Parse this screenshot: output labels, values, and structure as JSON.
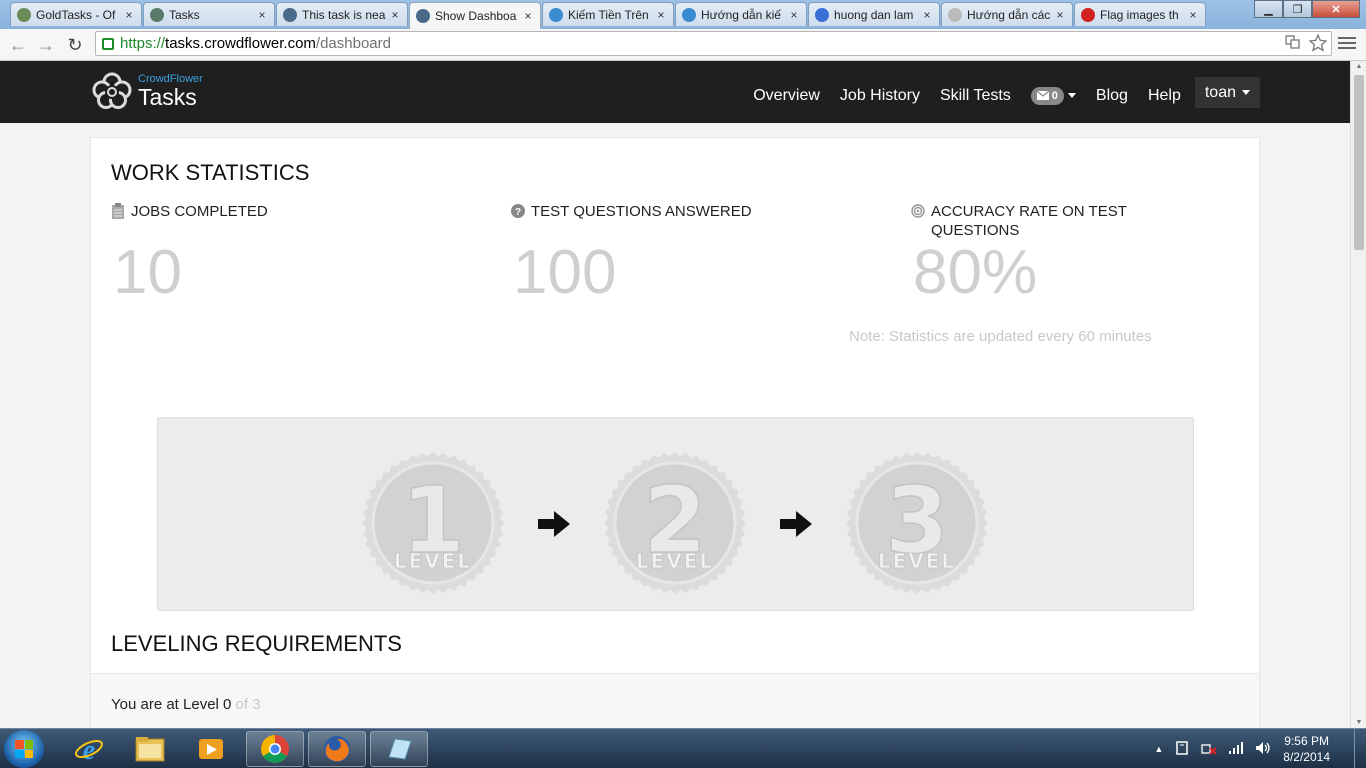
{
  "browser": {
    "tabs": [
      {
        "title": "GoldTasks - Of",
        "fav": "#6a8a5a"
      },
      {
        "title": "Tasks",
        "fav": "#5a7a6a"
      },
      {
        "title": "This task is nea",
        "fav": "#4a6a8a"
      },
      {
        "title": "Show Dashboa",
        "fav": "#4a6a8a",
        "active": true
      },
      {
        "title": "Kiếm Tiền Trên",
        "fav": "#3a8ad0"
      },
      {
        "title": "Hướng dẫn kiế",
        "fav": "#3a8ad0"
      },
      {
        "title": "huong dan lam",
        "fav": "#3b6fd8"
      },
      {
        "title": "Hướng dẫn các",
        "fav": "#bbbbbb"
      },
      {
        "title": "Flag images th",
        "fav": "#d22222"
      }
    ],
    "tab_close": "×",
    "url": {
      "scheme": "https://",
      "host": "tasks.crowdflower.com",
      "path": "/dashboard"
    },
    "nav": {
      "back": "←",
      "forward": "→",
      "reload": "↻"
    },
    "window": {
      "minimize": "▁",
      "maximize": "❐",
      "close": "✕"
    }
  },
  "site": {
    "brand_sub": "CrowdFlower",
    "brand_main": "Tasks",
    "nav": [
      "Overview",
      "Job History",
      "Skill Tests"
    ],
    "mail_count": "0",
    "nav2": [
      "Blog",
      "Help"
    ],
    "user": "toan"
  },
  "stats": {
    "title": "WORK STATISTICS",
    "items": [
      {
        "label": "JOBS COMPLETED",
        "value": "10",
        "icon": "clipboard-icon"
      },
      {
        "label": "TEST QUESTIONS ANSWERED",
        "value": "100",
        "icon": "question-icon"
      },
      {
        "label": "ACCURACY RATE ON TEST QUESTIONS",
        "value": "80%",
        "icon": "target-icon"
      }
    ],
    "note": "Note: Statistics are updated every 60 minutes"
  },
  "levels": {
    "badges": [
      {
        "number": "1",
        "label": "LEVEL"
      },
      {
        "number": "2",
        "label": "LEVEL"
      },
      {
        "number": "3",
        "label": "LEVEL"
      }
    ]
  },
  "requirements": {
    "title": "LEVELING REQUIREMENTS",
    "level_prefix": "You are at Level 0",
    "level_suffix": " of 3"
  },
  "taskbar": {
    "time": "9:56 PM",
    "date": "8/2/2014",
    "tray_arrow": "▲"
  },
  "colors": {
    "nav_bg": "#1f1f1f",
    "brand_accent": "#3aa0e0",
    "stat_value": "#cfcfcf",
    "url_green": "#1e8a2a"
  }
}
